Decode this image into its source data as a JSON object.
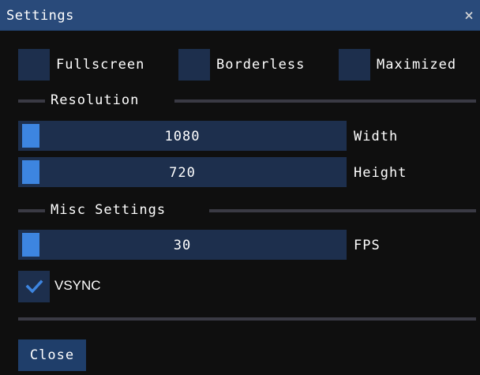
{
  "window": {
    "title": "Settings",
    "close_glyph": "×"
  },
  "checkboxes": [
    {
      "label": "Fullscreen",
      "checked": false
    },
    {
      "label": "Borderless",
      "checked": false
    },
    {
      "label": "Maximized",
      "checked": false
    }
  ],
  "sections": {
    "resolution": "Resolution",
    "misc": "Misc Settings"
  },
  "sliders": {
    "width": {
      "value": "1080",
      "label": "Width"
    },
    "height": {
      "value": "720",
      "label": "Height"
    },
    "fps": {
      "value": "30",
      "label": "FPS"
    }
  },
  "vsync": {
    "label": "VSYNC",
    "checked": true
  },
  "buttons": {
    "close": "Close"
  },
  "colors": {
    "title_bg": "#294a7a",
    "frame_bg": "#1d2f4d",
    "accent": "#3d85e0",
    "window_bg": "#0f0f0f"
  }
}
